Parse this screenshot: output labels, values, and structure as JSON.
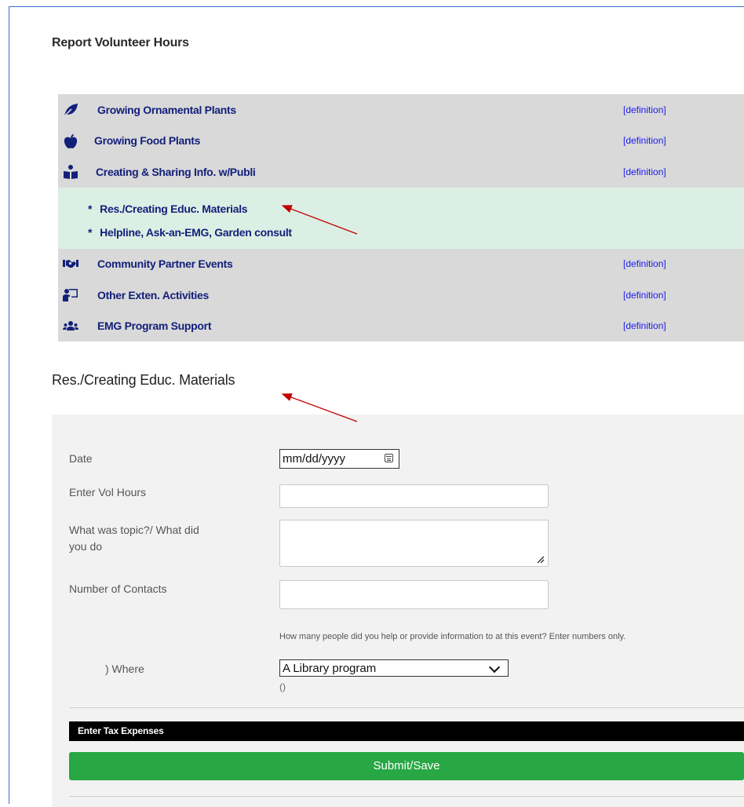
{
  "page": {
    "title": "Report Volunteer Hours"
  },
  "categories": [
    {
      "label": "Growing Ornamental Plants",
      "definition": "[definition]",
      "icon": "leaf-icon"
    },
    {
      "label": "Growing Food Plants",
      "definition": "[definition]",
      "icon": "apple-icon"
    },
    {
      "label": "Creating & Sharing Info. w/Publi",
      "definition": "[definition]",
      "icon": "reader-icon"
    }
  ],
  "subitems": [
    {
      "star": "*",
      "label": "Res./Creating Educ. Materials"
    },
    {
      "star": "*",
      "label": "Helpline, Ask-an-EMG, Garden consult"
    }
  ],
  "categories2": [
    {
      "label": "Community Partner Events",
      "definition": "[definition]",
      "icon": "handshake-icon"
    },
    {
      "label": "Other Exten. Activities",
      "definition": "[definition]",
      "icon": "teacher-icon"
    },
    {
      "label": "EMG Program Support",
      "definition": "[definition]",
      "icon": "users-icon"
    }
  ],
  "section": {
    "title": "Res./Creating Educ. Materials"
  },
  "form": {
    "date_label": "Date",
    "date_value": "mm/dd/yyyy",
    "hours_label": "Enter Vol Hours",
    "topic_label_1": "What was topic?/ What did",
    "topic_label_2": "you do",
    "contacts_label": "Number of Contacts",
    "contacts_help": "How many people did you help or provide information to at this event? Enter numbers only.",
    "where_label": ") Where",
    "where_value": "A Library program",
    "where_note": "()",
    "tax_label": "Enter Tax Expenses",
    "submit_label": "Submit/Save"
  },
  "colors": {
    "accent_green": "#28a745",
    "link_blue": "#13207a",
    "definition_blue": "#1a1aee",
    "annotation_red": "#c00000"
  }
}
